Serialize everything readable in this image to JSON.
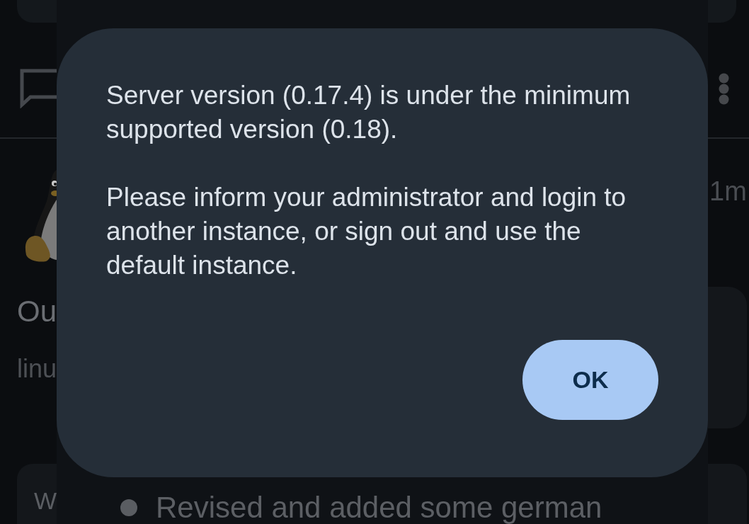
{
  "feed": {
    "post": {
      "title": "Ou",
      "community": "linu",
      "age": "1m"
    },
    "body": {
      "heading": "W",
      "list_items": [
        "Revised and added some german"
      ]
    }
  },
  "dialog": {
    "message": [
      "Server version (0.17.4) is under the minimum supported version (0.18).",
      "Please inform your administrator and login to another instance, or sign out and use the default instance."
    ],
    "buttons": [
      {
        "label": "OK"
      }
    ]
  }
}
